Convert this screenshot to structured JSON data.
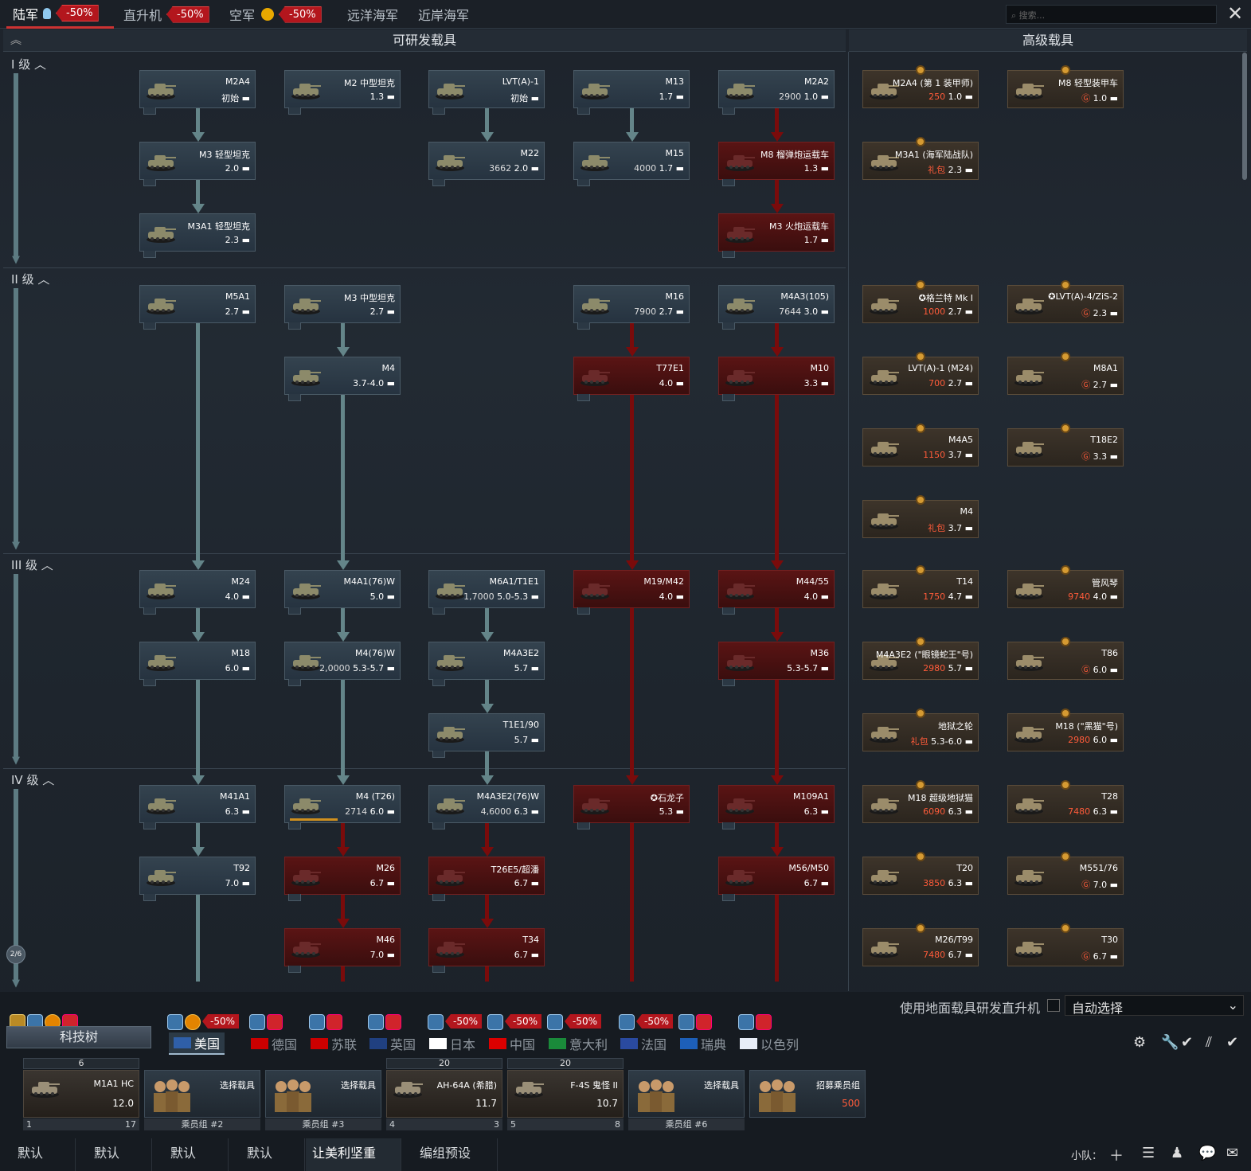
{
  "top_tabs": [
    {
      "label": "陆军",
      "discount": "-50%",
      "active": true
    },
    {
      "label": "直升机",
      "discount": "-50%"
    },
    {
      "label": "空军",
      "discount": "-50%"
    },
    {
      "label": "远洋海军"
    },
    {
      "label": "近岸海军"
    }
  ],
  "search_placeholder": "搜索...",
  "headers": {
    "research": "可研发载具",
    "premium": "高级载具"
  },
  "ranks": [
    "I 级",
    "II 级",
    "III 级",
    "IV 级"
  ],
  "page_indicator": "2/6",
  "cards": [
    {
      "name": "M2A4",
      "stat": "初始",
      "type": "g"
    },
    {
      "name": "M2 中型坦克",
      "stat": "1.3",
      "type": "g"
    },
    {
      "name": "LVT(A)-1",
      "stat": "初始",
      "type": "g"
    },
    {
      "name": "M13",
      "stat": "1.7",
      "type": "g"
    },
    {
      "name": "M2A2",
      "rp": "2900",
      "stat": "1.0",
      "type": "g"
    },
    {
      "name": "M3 轻型坦克",
      "stat": "2.0",
      "type": "g"
    },
    {
      "name": "M22",
      "rp": "3662",
      "stat": "2.0",
      "type": "g"
    },
    {
      "name": "M15",
      "rp": "4000",
      "stat": "1.7",
      "type": "g"
    },
    {
      "name": "M8 榴弹炮运载车",
      "stat": "1.3",
      "type": "r"
    },
    {
      "name": "M3A1 轻型坦克",
      "stat": "2.3",
      "type": "g"
    },
    {
      "name": "M3 火炮运载车",
      "stat": "1.7",
      "type": "r"
    },
    {
      "name": "M5A1",
      "stat": "2.7",
      "type": "g"
    },
    {
      "name": "M3 中型坦克",
      "stat": "2.7",
      "type": "g"
    },
    {
      "name": "M16",
      "rp": "7900",
      "stat": "2.7",
      "type": "g"
    },
    {
      "name": "M4A3(105)",
      "rp": "7644",
      "stat": "3.0",
      "type": "g"
    },
    {
      "name": "M4",
      "stat": "3.7-4.0",
      "type": "g"
    },
    {
      "name": "T77E1",
      "stat": "4.0",
      "type": "r"
    },
    {
      "name": "M10",
      "stat": "3.3",
      "type": "r"
    },
    {
      "name": "M24",
      "stat": "4.0",
      "type": "g"
    },
    {
      "name": "M4A1(76)W",
      "stat": "5.0",
      "type": "g"
    },
    {
      "name": "M6A1/T1E1",
      "rp": "1,7000",
      "stat": "5.0-5.3",
      "type": "g"
    },
    {
      "name": "M19/M42",
      "stat": "4.0",
      "type": "r"
    },
    {
      "name": "M44/55",
      "stat": "4.0",
      "type": "r"
    },
    {
      "name": "M18",
      "stat": "6.0",
      "type": "g"
    },
    {
      "name": "M4(76)W",
      "rp": "2,0000",
      "stat": "5.3-5.7",
      "type": "g"
    },
    {
      "name": "M4A3E2",
      "stat": "5.7",
      "type": "g"
    },
    {
      "name": "M36",
      "stat": "5.3-5.7",
      "type": "r"
    },
    {
      "name": "T1E1/90",
      "stat": "5.7",
      "type": "g"
    },
    {
      "name": "M41A1",
      "stat": "6.3",
      "type": "g"
    },
    {
      "name": "M4 (T26)",
      "rp": "2714",
      "stat": "6.0",
      "type": "g"
    },
    {
      "name": "M4A3E2(76)W",
      "rp": "4,6000",
      "stat": "6.3",
      "type": "g"
    },
    {
      "name": "✪石龙子",
      "stat": "5.3",
      "type": "r"
    },
    {
      "name": "M109A1",
      "stat": "6.3",
      "type": "r"
    },
    {
      "name": "T92",
      "stat": "7.0",
      "type": "g"
    },
    {
      "name": "M26",
      "stat": "6.7",
      "type": "r"
    },
    {
      "name": "T26E5/超潘",
      "stat": "6.7",
      "type": "r"
    },
    {
      "name": "M56/M50",
      "stat": "6.7",
      "type": "r"
    },
    {
      "name": "M46",
      "stat": "7.0",
      "type": "r"
    },
    {
      "name": "T34",
      "stat": "6.7",
      "type": "r"
    },
    {
      "name": "M2A4 (第 1 装甲师)",
      "ge": "250",
      "stat": "1.0",
      "type": "p"
    },
    {
      "name": "M8 轻型装甲车",
      "ge": "Ⓖ",
      "stat": "1.0",
      "type": "p"
    },
    {
      "name": "M3A1 (海军陆战队)",
      "ge": "礼包",
      "stat": "2.3",
      "type": "p"
    },
    {
      "name": "✪格兰特 Mk I",
      "ge": "1000",
      "stat": "2.7",
      "type": "p"
    },
    {
      "name": "✪LVT(A)-4/ZiS-2",
      "ge": "Ⓖ",
      "stat": "2.3",
      "type": "p"
    },
    {
      "name": "LVT(A)-1 (M24)",
      "ge": "700",
      "stat": "2.7",
      "type": "p"
    },
    {
      "name": "M8A1",
      "ge": "Ⓖ",
      "stat": "2.7",
      "type": "p"
    },
    {
      "name": "M4A5",
      "ge": "1150",
      "stat": "3.7",
      "type": "p"
    },
    {
      "name": "T18E2",
      "ge": "Ⓖ",
      "stat": "3.3",
      "type": "p"
    },
    {
      "name": "M4",
      "ge": "礼包",
      "stat": "3.7",
      "type": "p"
    },
    {
      "name": "T14",
      "ge": "1750",
      "stat": "4.7",
      "type": "p"
    },
    {
      "name": "管风琴",
      "ge": "9740",
      "stat": "4.0",
      "type": "p"
    },
    {
      "name": "M4A3E2 (\"眼镜蛇王\"号)",
      "ge": "2980",
      "stat": "5.7",
      "type": "p"
    },
    {
      "name": "T86",
      "ge": "Ⓖ",
      "stat": "6.0",
      "type": "p"
    },
    {
      "name": "地狱之轮",
      "ge": "礼包",
      "stat": "5.3-6.0",
      "type": "p"
    },
    {
      "name": "M18 (\"黑猫\"号)",
      "ge": "2980",
      "stat": "6.0",
      "type": "p"
    },
    {
      "name": "M18 超级地狱猫",
      "ge": "6090",
      "stat": "6.3",
      "type": "p"
    },
    {
      "name": "T28",
      "ge": "7480",
      "stat": "6.3",
      "type": "p"
    },
    {
      "name": "T20",
      "ge": "3850",
      "stat": "6.3",
      "type": "p"
    },
    {
      "name": "M551/76",
      "ge": "Ⓖ",
      "stat": "7.0",
      "type": "p"
    },
    {
      "name": "M26/T99",
      "ge": "7480",
      "stat": "6.7",
      "type": "p"
    },
    {
      "name": "T30",
      "ge": "Ⓖ",
      "stat": "6.7",
      "type": "p"
    }
  ],
  "auto": {
    "label": "使用地面载具研发直升机",
    "select": "自动选择"
  },
  "techtree_label": "科技树",
  "nations": [
    {
      "name": "美国",
      "active": true
    },
    {
      "name": "德国"
    },
    {
      "name": "苏联"
    },
    {
      "name": "英国"
    },
    {
      "name": "日本"
    },
    {
      "name": "中国"
    },
    {
      "name": "意大利"
    },
    {
      "name": "法国"
    },
    {
      "name": "瑞典"
    },
    {
      "name": "以色列"
    }
  ],
  "nation_discounts": [
    "-50%",
    "-50%",
    "-50%",
    "-50%",
    "-50%",
    "-50%",
    "-50%",
    "-50%"
  ],
  "crew_slots": [
    {
      "cap": "6",
      "name": "M1A1 HC",
      "stat": "12.0",
      "foot_left": "1",
      "foot_right": "17"
    },
    {
      "name": "选择载具",
      "foot": "乘员组 #2"
    },
    {
      "name": "选择载具",
      "foot": "乘员组 #3"
    },
    {
      "cap": "20",
      "name": "AH-64A (希腊)",
      "stat": "11.7",
      "foot_left": "4",
      "foot_right": "3"
    },
    {
      "cap": "20",
      "name": "F-4S 鬼怪 II",
      "stat": "10.7",
      "foot_left": "5",
      "foot_right": "8"
    },
    {
      "name": "选择载具",
      "foot": "乘员组 #6"
    },
    {
      "name": "招募乘员组",
      "stat": "500"
    }
  ],
  "bottom_tabs": [
    "默认",
    "默认",
    "默认",
    "默认",
    "让美利坚重新...",
    "编组预设"
  ],
  "squad_label": "小队："
}
